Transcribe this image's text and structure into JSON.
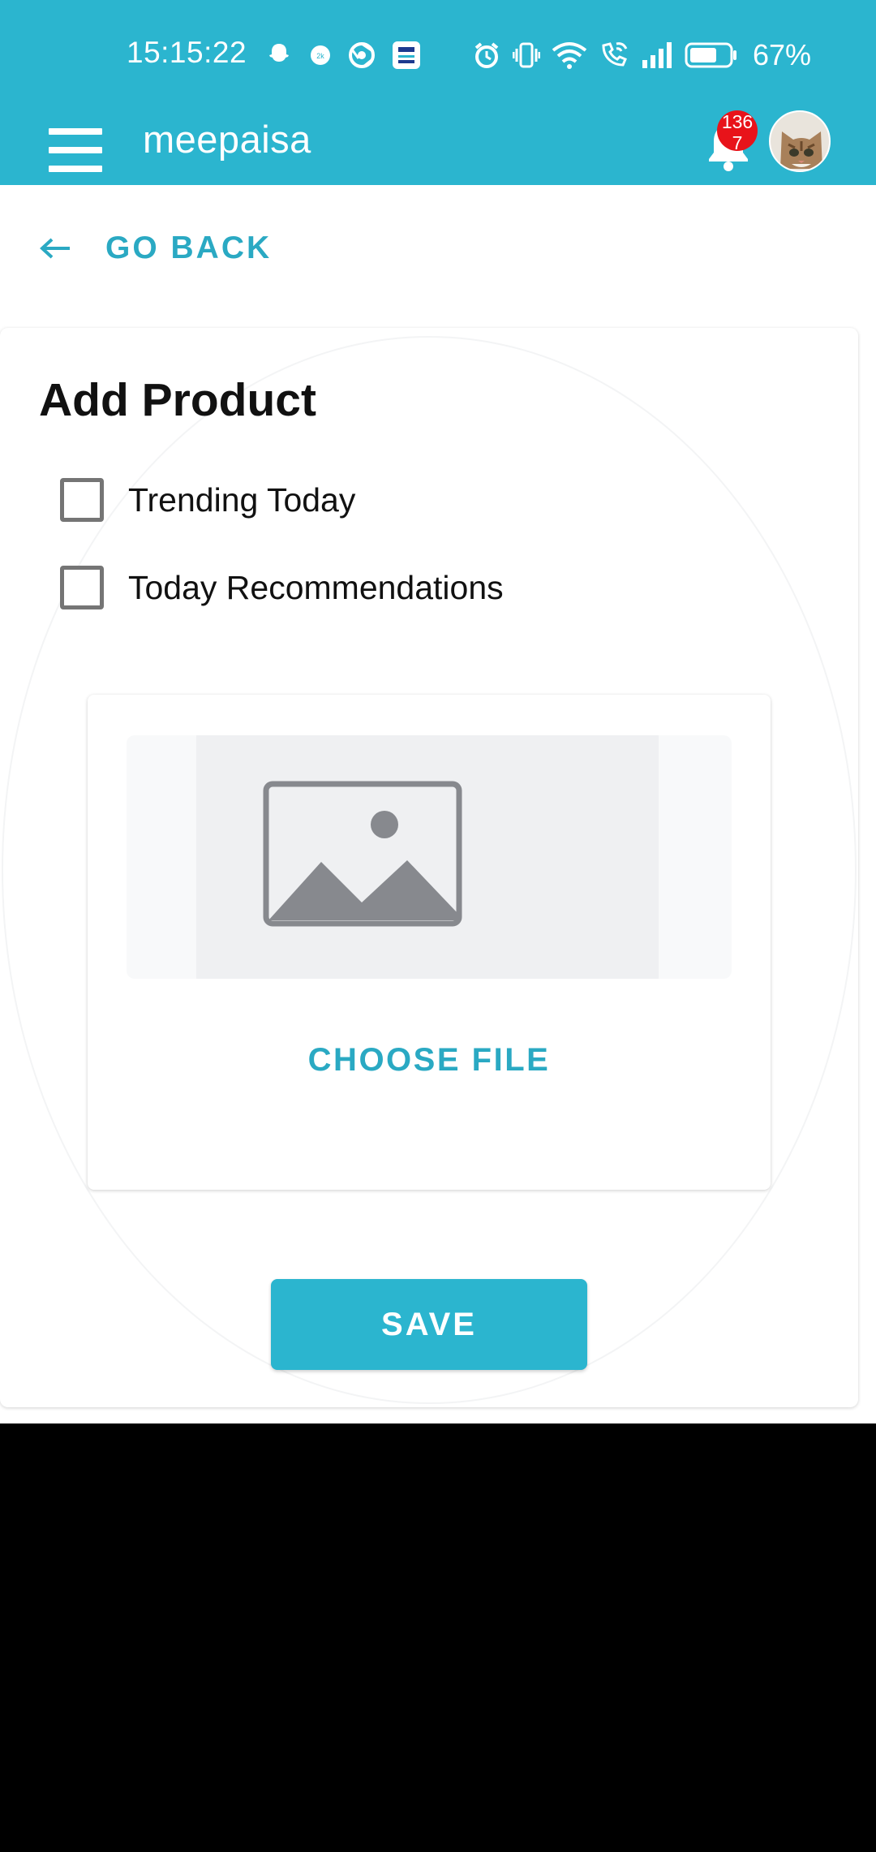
{
  "status_bar": {
    "time": "15:15:22",
    "battery_percent": "67%",
    "left_icons": [
      "snapchat-icon",
      "speed-meter-icon",
      "chrome-icon",
      "upi-icon"
    ],
    "right_icons": [
      "alarm-icon",
      "vibrate-icon",
      "wifi-icon",
      "wifi-calling-icon",
      "cellular-signal-icon",
      "battery-icon"
    ]
  },
  "app_bar": {
    "brand": "meepaisa",
    "notification_count": "136\n7",
    "accent_color": "#2bb5cf",
    "badge_color": "#e8131a"
  },
  "nav": {
    "go_back_label": "GO BACK"
  },
  "form": {
    "title": "Add Product",
    "checkboxes": [
      {
        "label": "Trending Today",
        "checked": false
      },
      {
        "label": "Today Recommendations",
        "checked": false
      }
    ],
    "upload": {
      "choose_file_label": "CHOOSE FILE"
    },
    "save_label": "SAVE"
  }
}
